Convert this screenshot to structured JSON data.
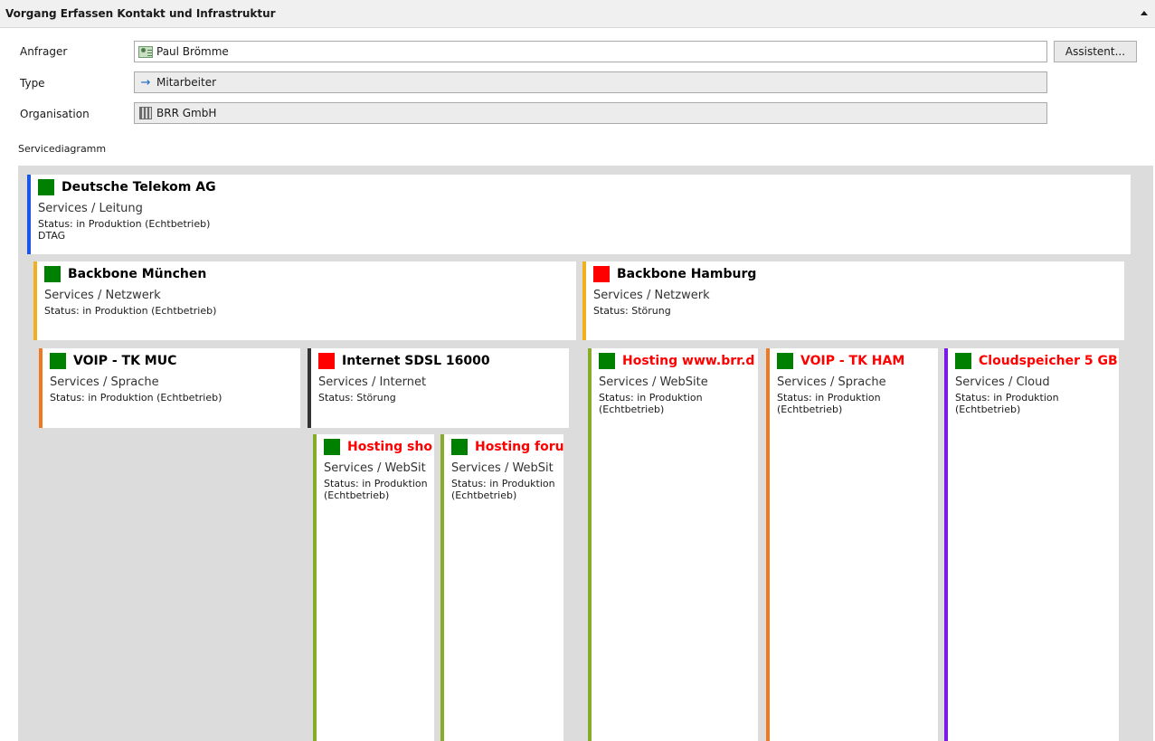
{
  "header": {
    "title": "Vorgang Erfassen Kontakt und Infrastruktur"
  },
  "form": {
    "requester": {
      "label": "Anfrager",
      "value": "Paul Brömme"
    },
    "type": {
      "label": "Type",
      "value": "Mitarbeiter"
    },
    "organisation": {
      "label": "Organisation",
      "value": "BRR GmbH"
    },
    "assistant_button": "Assistent..."
  },
  "diagram": {
    "label": "Servicediagramm",
    "nodes": [
      {
        "title": "Deutsche Telekom AG",
        "category": "Services / Leitung",
        "status": "Status: in Produktion (Echtbetrieb)",
        "extra": "DTAG",
        "status_color": "#008000",
        "accent": "#1a56e8"
      },
      {
        "title": "Backbone München",
        "category": "Services / Netzwerk",
        "status": "Status: in Produktion (Echtbetrieb)",
        "status_color": "#008000",
        "accent": "#f0b020"
      },
      {
        "title": "Backbone Hamburg",
        "category": "Services / Netzwerk",
        "status": "Status: Störung",
        "status_color": "#ff0000",
        "accent": "#f0b020"
      },
      {
        "title": "VOIP - TK MUC",
        "category": "Services / Sprache",
        "status": "Status: in Produktion (Echtbetrieb)",
        "status_color": "#008000",
        "accent": "#f07820"
      },
      {
        "title": "Internet SDSL 16000",
        "category": "Services / Internet",
        "status": "Status: Störung",
        "status_color": "#ff0000",
        "accent": "#333333"
      },
      {
        "title": "Hosting www.brr.d",
        "category": "Services / WebSite",
        "status": "Status: in Produktion (Echtbetrieb)",
        "status_color": "#008000",
        "accent": "#86ad2a"
      },
      {
        "title": "VOIP - TK HAM",
        "category": "Services / Sprache",
        "status": "Status: in Produktion (Echtbetrieb)",
        "status_color": "#008000",
        "accent": "#f07820"
      },
      {
        "title": "Cloudspeicher 5 GB",
        "category": "Services / Cloud",
        "status": "Status: in Produktion (Echtbetrieb)",
        "status_color": "#008000",
        "accent": "#7a1ae8"
      },
      {
        "title": "Hosting sho",
        "category": "Services / WebSit",
        "status": "Status: in Produktion (Echtbetrieb)",
        "status_color": "#008000",
        "accent": "#86ad2a"
      },
      {
        "title": "Hosting foru",
        "category": "Services / WebSit",
        "status": "Status: in Produktion (Echtbetrieb)",
        "status_color": "#008000",
        "accent": "#86ad2a"
      }
    ]
  }
}
